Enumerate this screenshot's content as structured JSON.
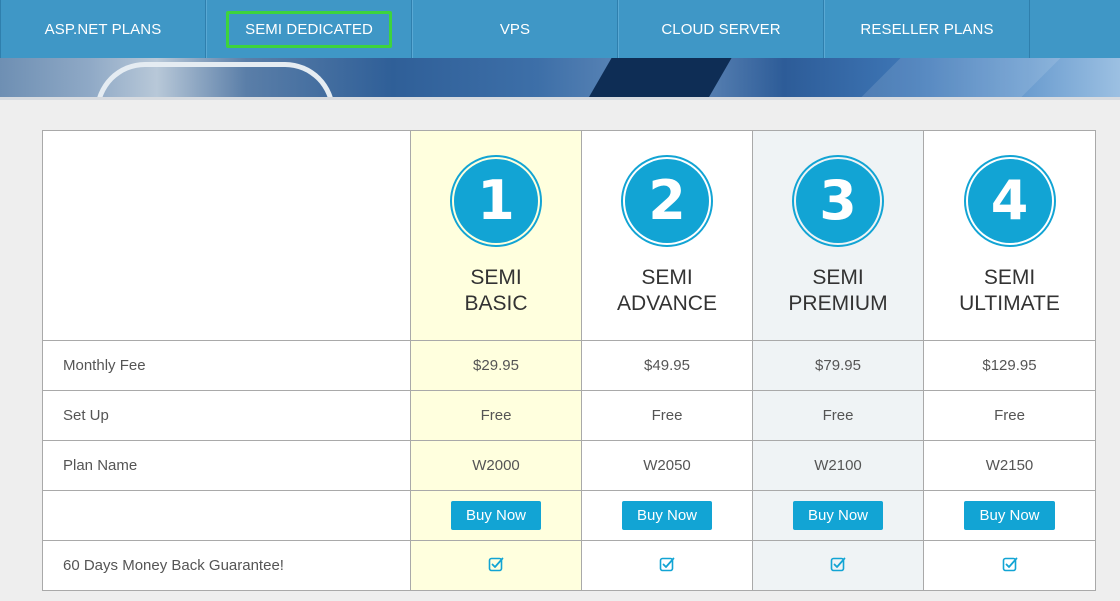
{
  "nav": {
    "items": [
      {
        "label": "ASP.NET PLANS"
      },
      {
        "label": "SEMI DEDICATED"
      },
      {
        "label": "VPS"
      },
      {
        "label": "CLOUD SERVER"
      },
      {
        "label": "RESELLER PLANS"
      }
    ]
  },
  "plans": [
    {
      "number": "1",
      "name_line1": "SEMI",
      "name_line2": "BASIC",
      "monthly_fee": "$29.95",
      "setup": "Free",
      "plan_name": "W2000",
      "buy_label": "Buy Now"
    },
    {
      "number": "2",
      "name_line1": "SEMI",
      "name_line2": "ADVANCE",
      "monthly_fee": "$49.95",
      "setup": "Free",
      "plan_name": "W2050",
      "buy_label": "Buy Now"
    },
    {
      "number": "3",
      "name_line1": "SEMI",
      "name_line2": "PREMIUM",
      "monthly_fee": "$79.95",
      "setup": "Free",
      "plan_name": "W2100",
      "buy_label": "Buy Now"
    },
    {
      "number": "4",
      "name_line1": "SEMI",
      "name_line2": "ULTIMATE",
      "monthly_fee": "$129.95",
      "setup": "Free",
      "plan_name": "W2150",
      "buy_label": "Buy Now"
    }
  ],
  "rows": {
    "monthly_fee": "Monthly Fee",
    "setup": "Set Up",
    "plan_name": "Plan Name",
    "guarantee": "60 Days Money Back Guarantee!"
  },
  "icons": {
    "check": "check-square-icon",
    "plan_badge": "number-circle"
  },
  "colors": {
    "nav_bg": "#3f97c6",
    "accent": "#12a4d4",
    "highlight_border": "#3dd43d",
    "col_basic_bg": "#ffffde",
    "col_premium_bg": "#eff3f5",
    "guarantee_text": "#2a9ec9"
  }
}
